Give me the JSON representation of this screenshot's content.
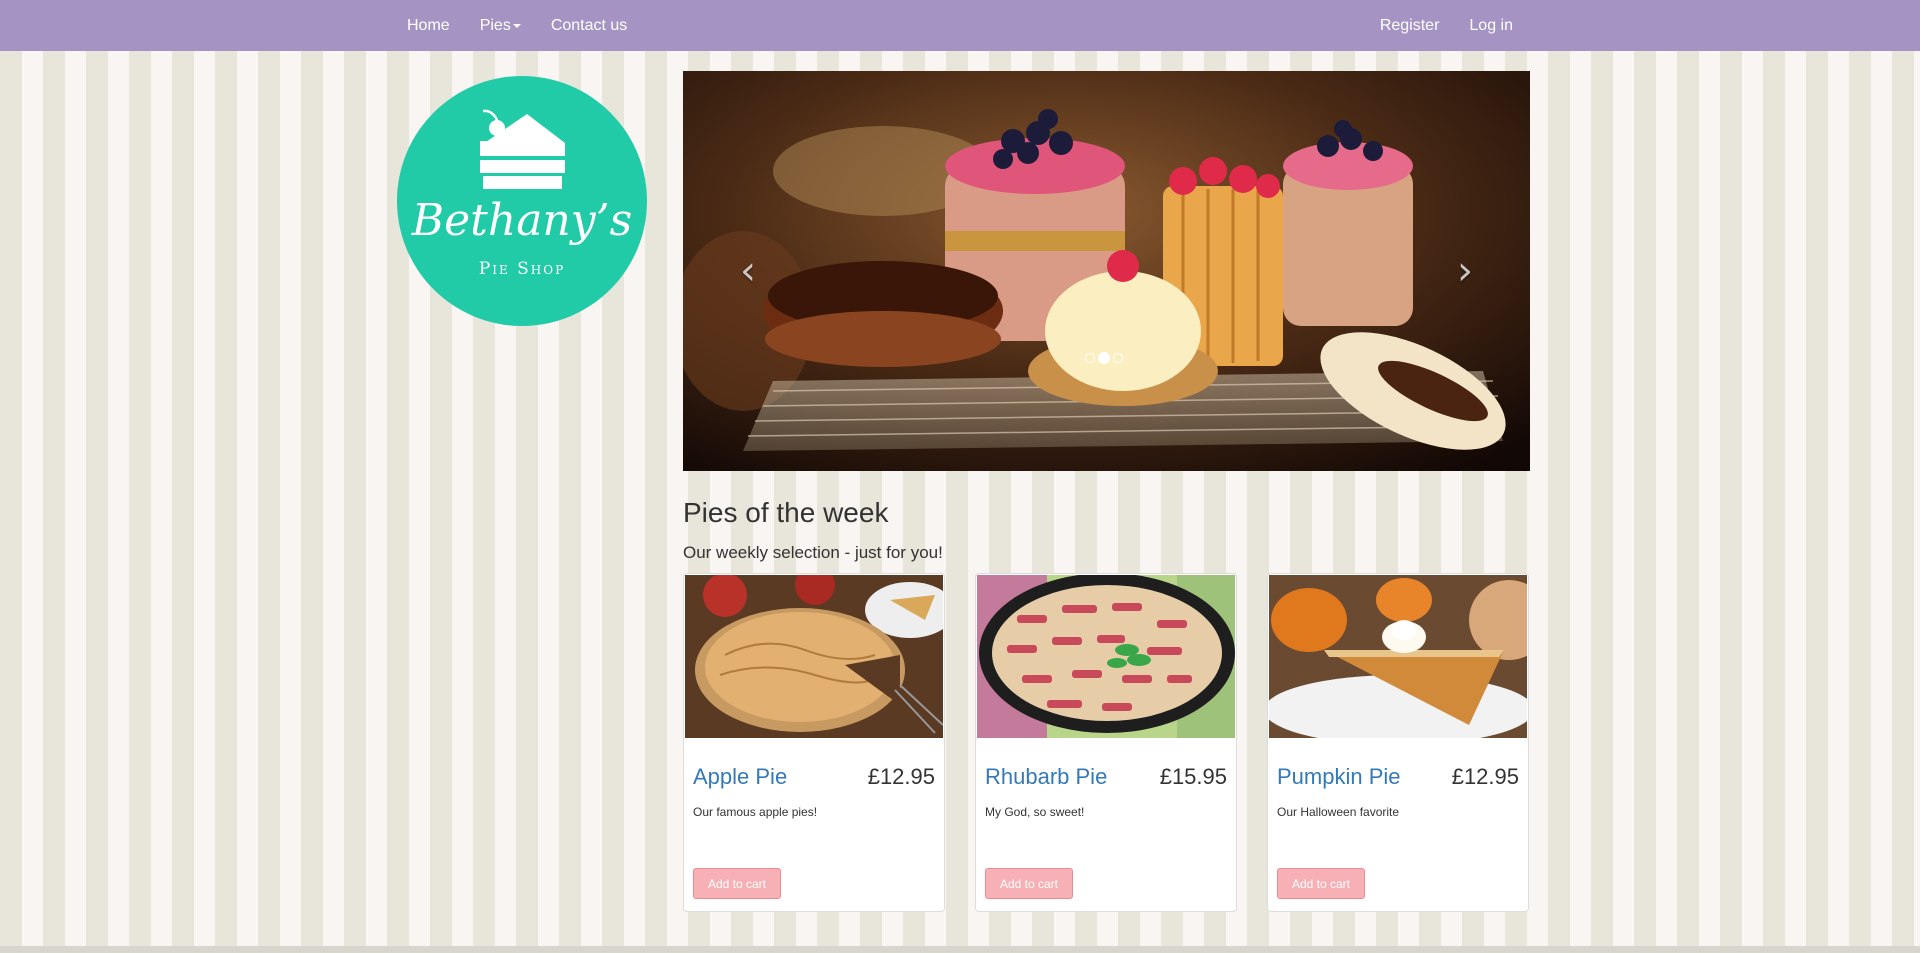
{
  "nav": {
    "left": [
      {
        "label": "Home"
      },
      {
        "label": "Pies",
        "dropdown": true
      },
      {
        "label": "Contact us"
      }
    ],
    "right": [
      {
        "label": "Register"
      },
      {
        "label": "Log in"
      }
    ]
  },
  "logo": {
    "script": "Bethany’s",
    "sub": "Pie Shop"
  },
  "carousel": {
    "prev_icon": "chevron-left-icon",
    "next_icon": "chevron-right-icon",
    "slide_count": 3,
    "active_slide": 2
  },
  "section": {
    "title": "Pies of the week",
    "subtitle": "Our weekly selection - just for you!"
  },
  "pies": [
    {
      "name": "Apple Pie",
      "price": "£12.95",
      "description": "Our famous apple pies!",
      "button": "Add to cart"
    },
    {
      "name": "Rhubarb Pie",
      "price": "£15.95",
      "description": "My God, so sweet!",
      "button": "Add to cart"
    },
    {
      "name": "Pumpkin Pie",
      "price": "£12.95",
      "description": "Our Halloween favorite",
      "button": "Add to cart"
    }
  ],
  "colors": {
    "navbar": "#a594c3",
    "logo": "#22cba8",
    "link": "#337ab7",
    "button": "#f7b0b5"
  }
}
